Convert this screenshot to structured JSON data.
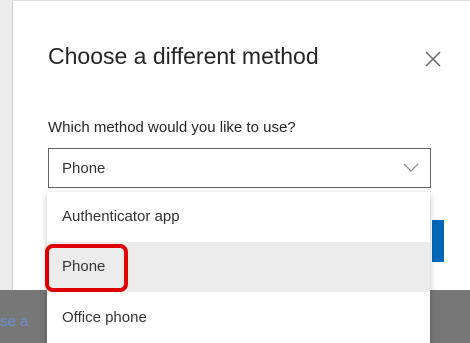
{
  "background": {
    "partial_link_text": "se a"
  },
  "dialog": {
    "title": "Choose a different method",
    "close_icon": "close-icon",
    "question": "Which method would you like to use?",
    "select": {
      "value": "Phone",
      "icon": "chevron-down-icon"
    },
    "options": [
      {
        "label": "Authenticator app",
        "selected": false
      },
      {
        "label": "Phone",
        "selected": true
      },
      {
        "label": "Office phone",
        "selected": false
      }
    ],
    "highlight_color": "#e00000",
    "accent_color": "#0067b8"
  }
}
